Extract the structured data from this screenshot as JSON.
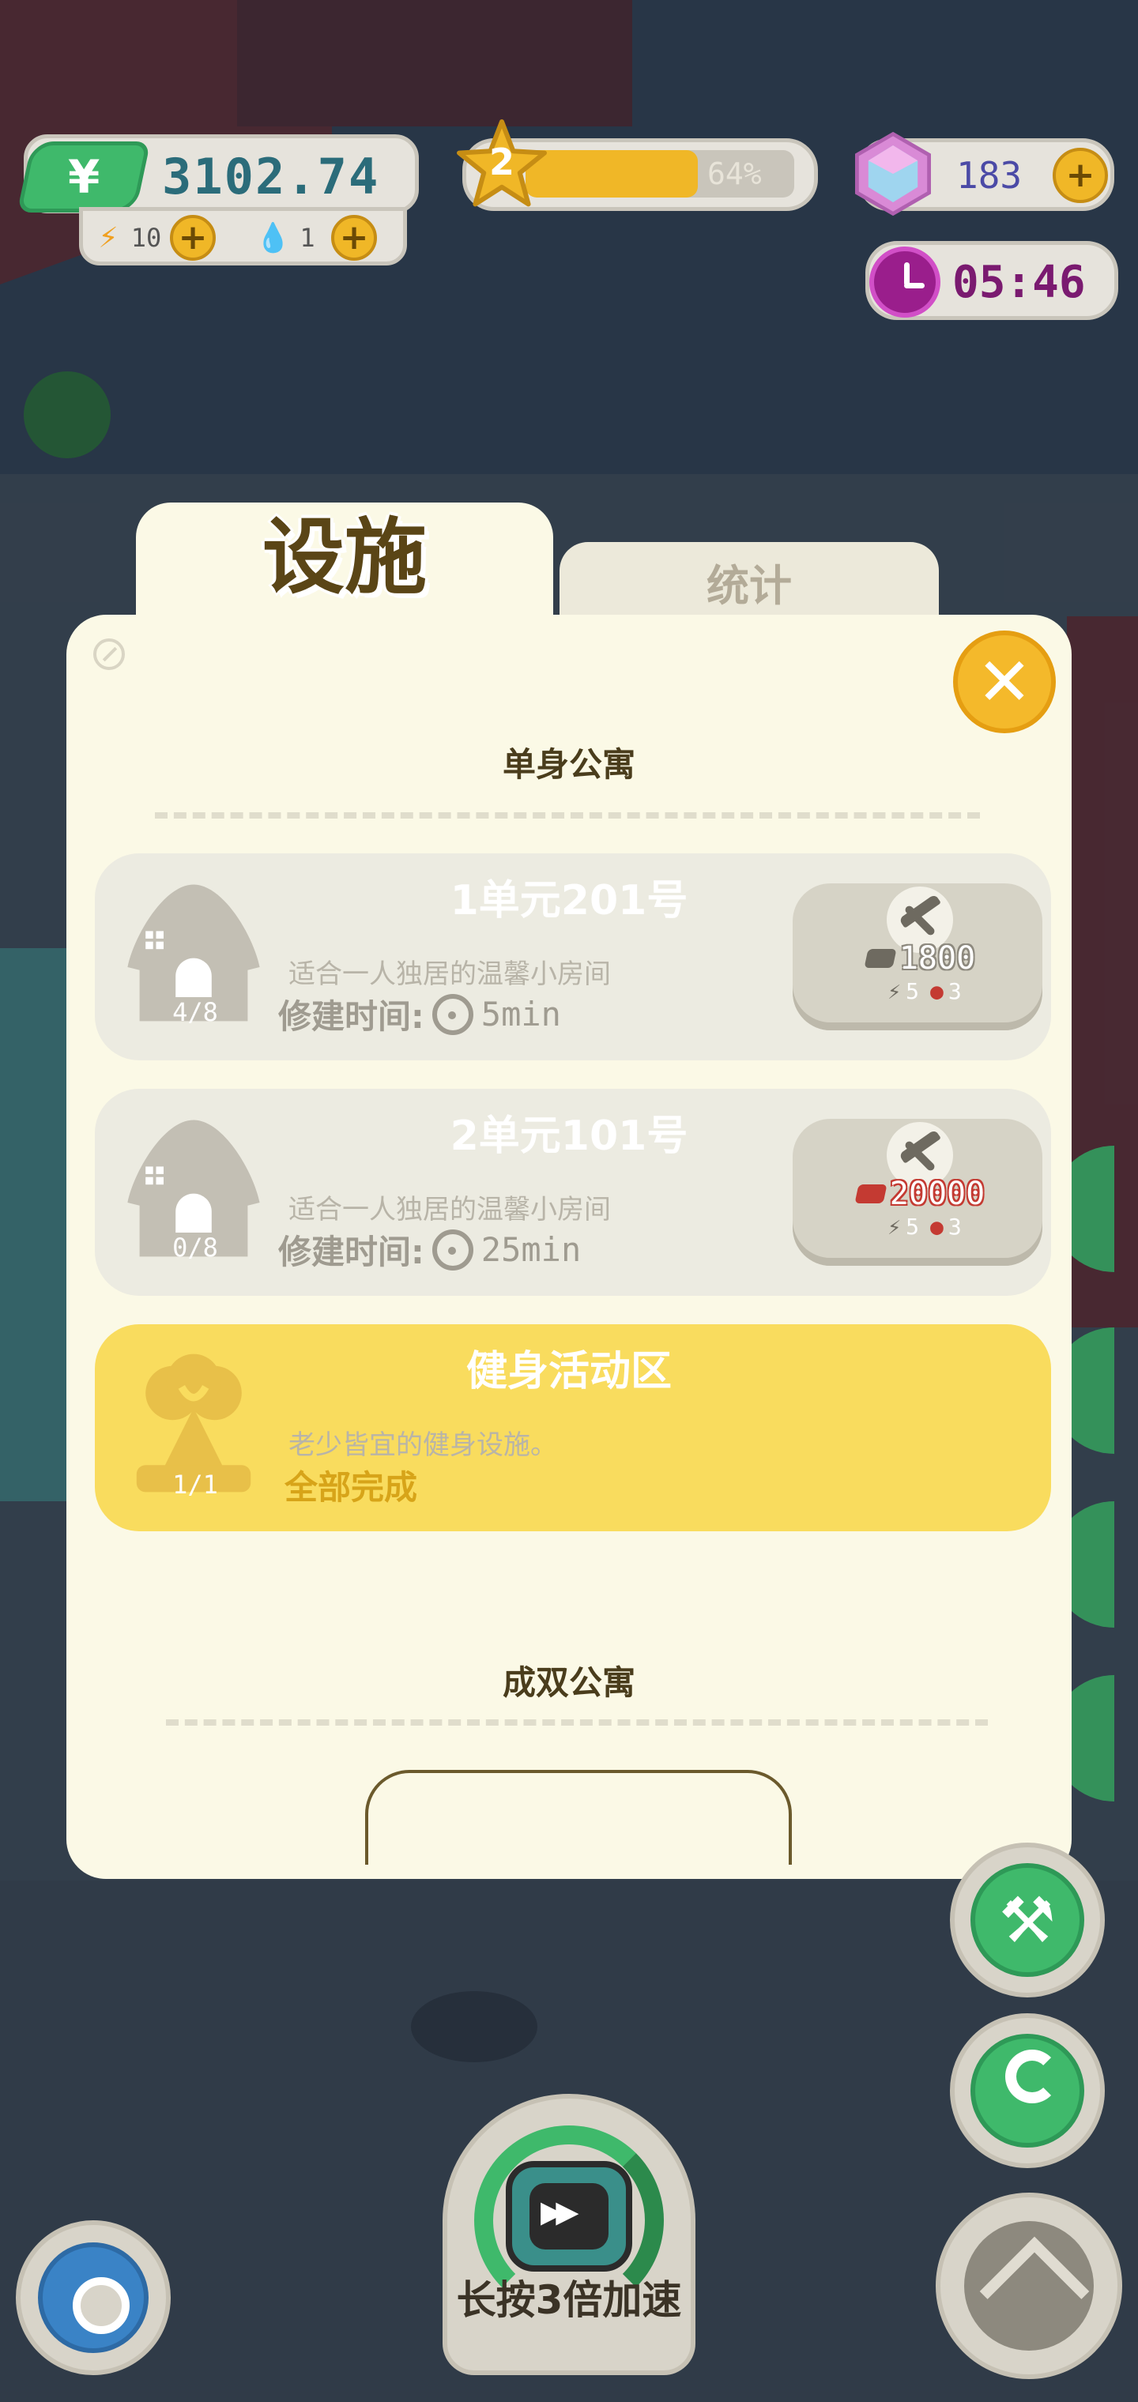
{
  "hud": {
    "money": "3102.74",
    "money_icon": "yuan-icon",
    "energy": "10",
    "water": "1",
    "level": "2",
    "level_progress_pct": "64%",
    "level_progress": 0.64,
    "gems": "183",
    "timer": "05:46"
  },
  "tabs": {
    "active": "设施",
    "inactive": "统计"
  },
  "sections": [
    {
      "title": "单身公寓",
      "cards": [
        {
          "title": "1单元201号",
          "desc": "适合一人独居的温馨小房间",
          "time_label": "修建时间:",
          "time_value": "5min",
          "count": "4/8",
          "cost": "1800",
          "energy_cost": "5",
          "water_cost": "3"
        },
        {
          "title": "2单元101号",
          "desc": "适合一人独居的温馨小房间",
          "time_label": "修建时间:",
          "time_value": "25min",
          "count": "0/8",
          "cost": "20000",
          "energy_cost": "5",
          "water_cost": "3"
        },
        {
          "title": "健身活动区",
          "desc": "老少皆宜的健身设施。",
          "status": "全部完成",
          "count": "1/1"
        }
      ]
    },
    {
      "title": "成双公寓"
    }
  ],
  "bottom": {
    "speed_label": "长按3倍加速"
  },
  "colors": {
    "accent_yellow": "#f0b727",
    "green": "#3fb96b",
    "panel_bg": "#fbf9e6",
    "card_gray": "#ecebe1",
    "card_done": "#f9dc5e",
    "cost_red": "#c43a32",
    "timer_purple": "#9a1e8c"
  }
}
